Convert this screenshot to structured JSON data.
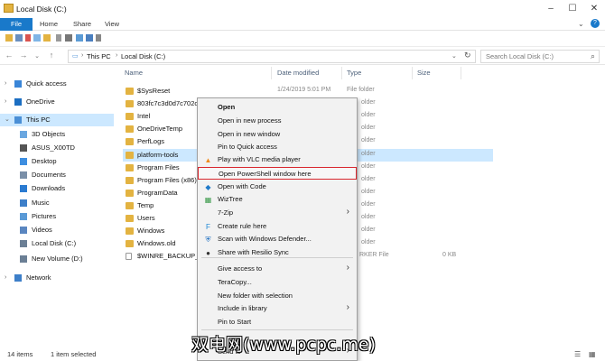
{
  "window": {
    "title": "Local Disk (C:)"
  },
  "ribbon": {
    "tabs": [
      "File",
      "Home",
      "Share",
      "View"
    ]
  },
  "address": {
    "crumbs": [
      "This PC",
      "Local Disk (C:)"
    ],
    "search_placeholder": "Search Local Disk (C:)"
  },
  "columns": {
    "name": "Name",
    "date": "Date modified",
    "type": "Type",
    "size": "Size"
  },
  "nav": {
    "items": [
      {
        "label": "Quick access",
        "icon": "star-icon",
        "color": "#3a86d8"
      },
      {
        "label": "OneDrive",
        "icon": "cloud-icon",
        "color": "#1b6ec2"
      },
      {
        "label": "This PC",
        "icon": "computer-icon",
        "color": "#4a8fd6"
      },
      {
        "label": "3D Objects",
        "icon": "cube-icon",
        "color": "#6aa7e0"
      },
      {
        "label": "ASUS_X00TD",
        "icon": "phone-icon",
        "color": "#555555"
      },
      {
        "label": "Desktop",
        "icon": "desktop-icon",
        "color": "#3d8ee0"
      },
      {
        "label": "Documents",
        "icon": "documents-icon",
        "color": "#7a8fa8"
      },
      {
        "label": "Downloads",
        "icon": "download-icon",
        "color": "#2b7bd1"
      },
      {
        "label": "Music",
        "icon": "music-icon",
        "color": "#3d7fc9"
      },
      {
        "label": "Pictures",
        "icon": "pictures-icon",
        "color": "#5a9ad6"
      },
      {
        "label": "Videos",
        "icon": "videos-icon",
        "color": "#5a86c0"
      },
      {
        "label": "Local Disk (C:)",
        "icon": "drive-icon",
        "color": "#6b7f95"
      },
      {
        "label": "New Volume (D:)",
        "icon": "drive-icon",
        "color": "#6b7f95"
      },
      {
        "label": "Network",
        "icon": "network-icon",
        "color": "#3d7fc9"
      }
    ]
  },
  "files": [
    {
      "name": "$SysReset",
      "date": "1/24/2019 5:01 PM",
      "type": "File folder",
      "size": ""
    },
    {
      "name": "803fc7c3d0d7c702c",
      "date": "",
      "type": "older",
      "size": ""
    },
    {
      "name": "Intel",
      "date": "",
      "type": "older",
      "size": ""
    },
    {
      "name": "OneDriveTemp",
      "date": "",
      "type": "older",
      "size": ""
    },
    {
      "name": "PerfLogs",
      "date": "",
      "type": "older",
      "size": ""
    },
    {
      "name": "platform-tools",
      "date": "",
      "type": "older",
      "size": ""
    },
    {
      "name": "Program Files",
      "date": "",
      "type": "older",
      "size": ""
    },
    {
      "name": "Program Files (x86)",
      "date": "",
      "type": "older",
      "size": ""
    },
    {
      "name": "ProgramData",
      "date": "",
      "type": "older",
      "size": ""
    },
    {
      "name": "Temp",
      "date": "",
      "type": "older",
      "size": ""
    },
    {
      "name": "Users",
      "date": "",
      "type": "older",
      "size": ""
    },
    {
      "name": "Windows",
      "date": "",
      "type": "older",
      "size": ""
    },
    {
      "name": "Windows.old",
      "date": "",
      "type": "older",
      "size": ""
    },
    {
      "name": "$WINRE_BACKUP_P",
      "date": "",
      "type": "RKER File",
      "size": "0 KB"
    }
  ],
  "context_menu": {
    "items": [
      {
        "label": "Open",
        "bold": true,
        "icon": ""
      },
      {
        "label": "Open in new process",
        "icon": ""
      },
      {
        "label": "Open in new window",
        "icon": ""
      },
      {
        "label": "Pin to Quick access",
        "icon": ""
      },
      {
        "label": "Play with VLC media player",
        "icon": "vlc-icon"
      },
      {
        "label": "Open PowerShell window here",
        "icon": "",
        "highlight": true
      },
      {
        "label": "Open with Code",
        "icon": "vscode-icon"
      },
      {
        "label": "WizTree",
        "icon": "wiztree-icon"
      },
      {
        "label": "7-Zip",
        "icon": "",
        "submenu": true
      },
      {
        "label": "Create rule here",
        "icon": "rule-icon"
      },
      {
        "label": "Scan with Windows Defender...",
        "icon": "defender-icon"
      },
      {
        "label": "Share with Resilio Sync",
        "icon": "resilio-icon"
      },
      {
        "label": "Give access to",
        "icon": "",
        "submenu": true
      },
      {
        "label": "TeraCopy...",
        "icon": ""
      },
      {
        "label": "New folder with selection",
        "icon": ""
      },
      {
        "label": "Include in library",
        "icon": "",
        "submenu": true
      },
      {
        "label": "Pin to Start",
        "icon": ""
      },
      {
        "label": "Send to",
        "icon": "",
        "submenu": true
      }
    ]
  },
  "status": {
    "count": "14 items",
    "selected": "1 item selected"
  },
  "watermark": "双电网(www.pcpc.me)",
  "colors": {
    "accent": "#1979ca",
    "selection": "#cce8ff",
    "highlight_border": "#d8262d",
    "folder": "#e3b341"
  }
}
